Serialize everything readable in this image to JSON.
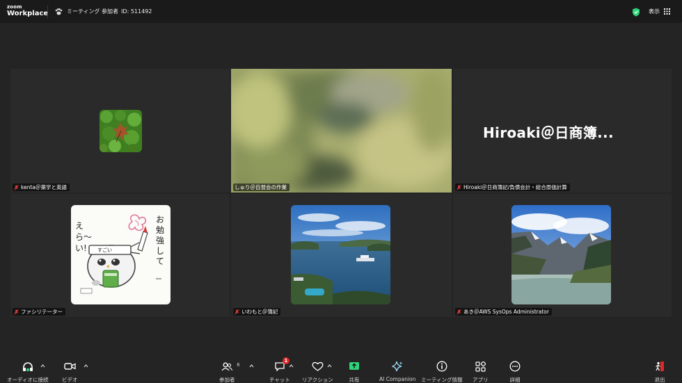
{
  "app": {
    "logo_line1": "zoom",
    "logo_line2": "Workplace"
  },
  "header": {
    "meeting_label": "ミーティング 参加者",
    "meeting_id": "ID: 511492",
    "view_label": "表示",
    "accent_color": "#2ed47a"
  },
  "participants": [
    {
      "name": "kenta＠薬学と英語",
      "muted": true,
      "display": "avatar",
      "avatar": "green-moss-leaf"
    },
    {
      "name": "しゅり＠自習会の作業",
      "muted": false,
      "display": "video",
      "active_speaker": true
    },
    {
      "name": "Hiroaki＠日商簿記/負債会計・総合原価計算",
      "muted": true,
      "display": "name",
      "big_name": "Hiroaki＠日商簿..."
    },
    {
      "name": "ファシリテーター",
      "muted": true,
      "display": "avatar",
      "avatar": "illustration-card"
    },
    {
      "name": "いわもと＠簿記",
      "muted": true,
      "display": "avatar",
      "avatar": "harbor-view"
    },
    {
      "name": "あき＠AWS SysOps Administrator",
      "muted": true,
      "display": "avatar",
      "avatar": "mountain-river"
    }
  ],
  "illustration_text": {
    "right": "お勉強して",
    "left": "えら〜い!",
    "band": "すごい"
  },
  "toolbar": {
    "audio": "オーディオに接続",
    "video": "ビデオ",
    "participants": "参加者",
    "participants_count": "6",
    "chat": "チャット",
    "chat_badge": "1",
    "reactions": "リアクション",
    "share": "共有",
    "ai": "AI Companion",
    "info": "ミーティング情報",
    "apps": "アプリ",
    "more": "詳細",
    "leave": "退出"
  }
}
